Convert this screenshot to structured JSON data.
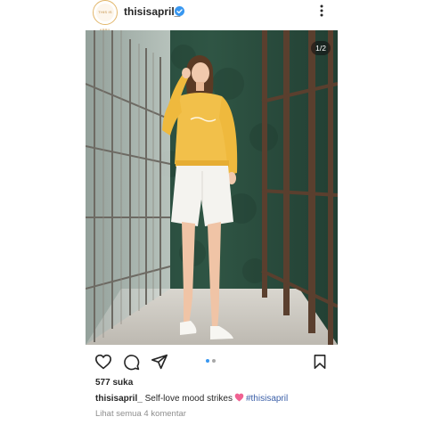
{
  "post": {
    "username": "thisisapril_",
    "avatar_text": "THIS IS APRIL",
    "page_counter": "1/2",
    "likes": "577 suka",
    "caption": {
      "username": "thisisapril_",
      "text": "Self-love mood strikes",
      "emoji": "pink-heart-icon",
      "hashtag": "#thisisapril"
    },
    "view_comments": "Lihat semua 4 komentar",
    "carousel": {
      "total": 2,
      "active": 1
    }
  },
  "colors": {
    "verified": "#3897f0",
    "dot_active": "#3897f0",
    "dot_inactive": "#a8a8a8",
    "hashtag": "#3b5fa8",
    "muted_text": "#8e8e8e",
    "heart": "#f06292"
  },
  "icons": [
    "verified-badge-icon",
    "more-options-icon",
    "heart-icon",
    "comment-icon",
    "share-icon",
    "bookmark-icon"
  ]
}
